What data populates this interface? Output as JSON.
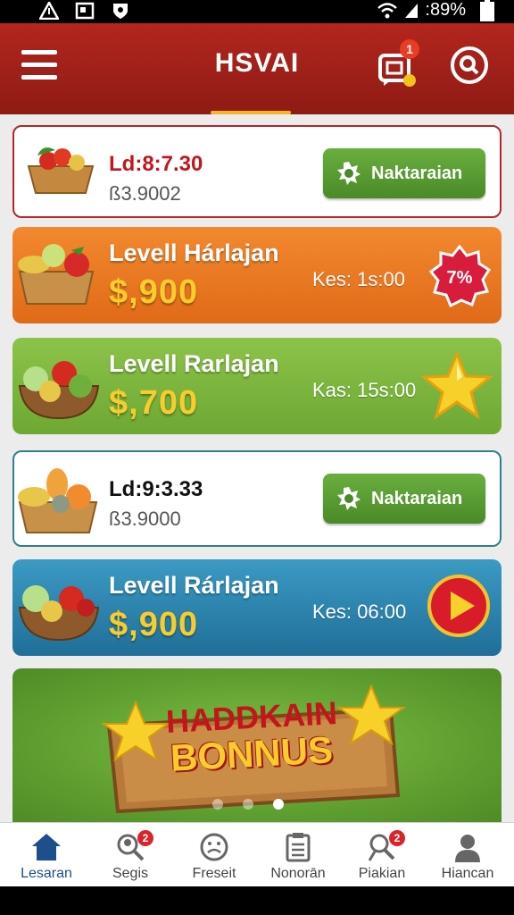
{
  "status_bar": {
    "battery_text": ":89%"
  },
  "app_bar": {
    "title": "HSVAI",
    "notification_count": "1"
  },
  "cards": [
    {
      "style": "white",
      "price": "Ld:8:7.30",
      "price_color": "#c4151c",
      "sub": "ß3.9002",
      "button_label": "Naktaraian"
    },
    {
      "style": "orange",
      "title": "Levell Hárlajan",
      "amount": "$,900",
      "time": "Kes: 1s:00",
      "badge_text": "7%"
    },
    {
      "style": "green",
      "title": "Levell Rarlajan",
      "amount": "$,700",
      "time": "Kas: 15s:00",
      "icon": "star-icon"
    },
    {
      "style": "white",
      "price": "Ld:9:3.33",
      "price_color": "#111111",
      "sub": "ß3.9000",
      "button_label": "Naktaraian"
    },
    {
      "style": "blue",
      "title": "Levell Rárlajan",
      "amount": "$,900",
      "time": "Kes: 06:00",
      "icon": "play-icon"
    }
  ],
  "bonus_banner": {
    "line1": "HADDKAIN",
    "line2": "BONNUS",
    "dots": 3,
    "active_dot": 2
  },
  "bottom_nav": [
    {
      "label": "Lesaran",
      "icon": "home-icon",
      "active": true
    },
    {
      "label": "Segis",
      "icon": "search-people-icon",
      "badge": "2"
    },
    {
      "label": "Freseit",
      "icon": "smiley-icon"
    },
    {
      "label": "Nonorān",
      "icon": "clipboard-icon"
    },
    {
      "label": "Piakian",
      "icon": "group-icon",
      "badge": "2"
    },
    {
      "label": "Hiancan",
      "icon": "person-icon"
    }
  ],
  "colors": {
    "accent_red": "#b3261e",
    "gold": "#f7cc2c",
    "button_green": "#5a9c33",
    "nav_active": "#1d4f8c"
  }
}
